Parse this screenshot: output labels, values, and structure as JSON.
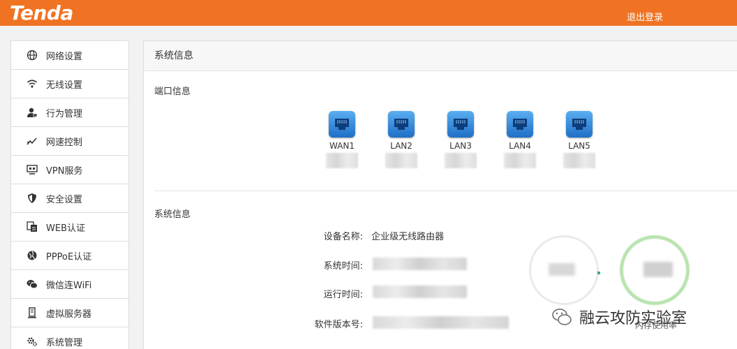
{
  "header": {
    "brand": "Tenda",
    "logout": "退出登录",
    "bg_color": "#ef7323"
  },
  "sidebar": {
    "items": [
      {
        "label": "网络设置",
        "icon": "globe-icon"
      },
      {
        "label": "无线设置",
        "icon": "wifi-icon"
      },
      {
        "label": "行为管理",
        "icon": "user-manage-icon"
      },
      {
        "label": "网速控制",
        "icon": "speed-chart-icon"
      },
      {
        "label": "VPN服务",
        "icon": "vpn-icon"
      },
      {
        "label": "安全设置",
        "icon": "shield-icon"
      },
      {
        "label": "WEB认证",
        "icon": "web-auth-icon"
      },
      {
        "label": "PPPoE认证",
        "icon": "pppoe-icon"
      },
      {
        "label": "微信连WiFi",
        "icon": "wechat-icon"
      },
      {
        "label": "虚拟服务器",
        "icon": "server-icon"
      },
      {
        "label": "系统管理",
        "icon": "gear-icon"
      }
    ]
  },
  "main": {
    "title": "系统信息",
    "ports_section": "端口信息",
    "ports": [
      "WAN1",
      "LAN2",
      "LAN3",
      "LAN4",
      "LAN5"
    ],
    "sysinfo_section": "系统信息",
    "rows": [
      {
        "label": "设备名称:",
        "value": "企业级无线路由器"
      },
      {
        "label": "系统时间:",
        "value": ""
      },
      {
        "label": "运行时间:",
        "value": ""
      },
      {
        "label": "软件版本号:",
        "value": ""
      }
    ],
    "gauge_label_right": "内存使用率"
  },
  "watermark": {
    "text": "融云攻防实验室"
  }
}
